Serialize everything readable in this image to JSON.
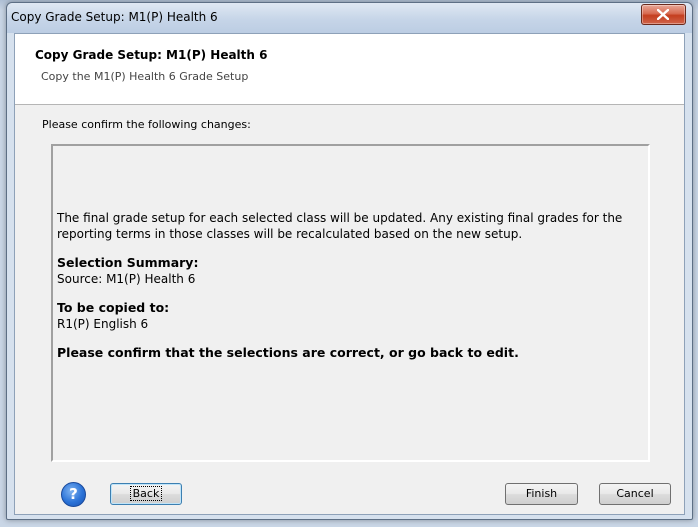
{
  "window": {
    "title": "Copy Grade Setup: M1(P) Health 6"
  },
  "header": {
    "title": "Copy Grade Setup: M1(P) Health 6",
    "subtitle": "Copy the M1(P) Health 6 Grade Setup"
  },
  "body": {
    "confirm_label": "Please confirm the following changes:",
    "description_line1": "The final grade setup for each selected class will be updated. Any existing final grades for the",
    "description_line2": "reporting terms in those classes will be recalculated based on the new setup.",
    "selection_summary_heading": "Selection Summary:",
    "source_line": "Source: M1(P) Health 6",
    "copied_to_heading": "To be copied to:",
    "copied_to_value": "R1(P) English 6",
    "confirm_prompt": "Please confirm that the selections are correct, or go back to edit."
  },
  "footer": {
    "help_glyph": "?",
    "back_label": "Back",
    "finish_label": "Finish",
    "cancel_label": "Cancel"
  },
  "icons": {
    "close": "close-icon",
    "help": "help-icon"
  },
  "colors": {
    "close_button": "#c43e1f",
    "help_button": "#2b73d8",
    "titlebar": "#c6d5e8"
  }
}
